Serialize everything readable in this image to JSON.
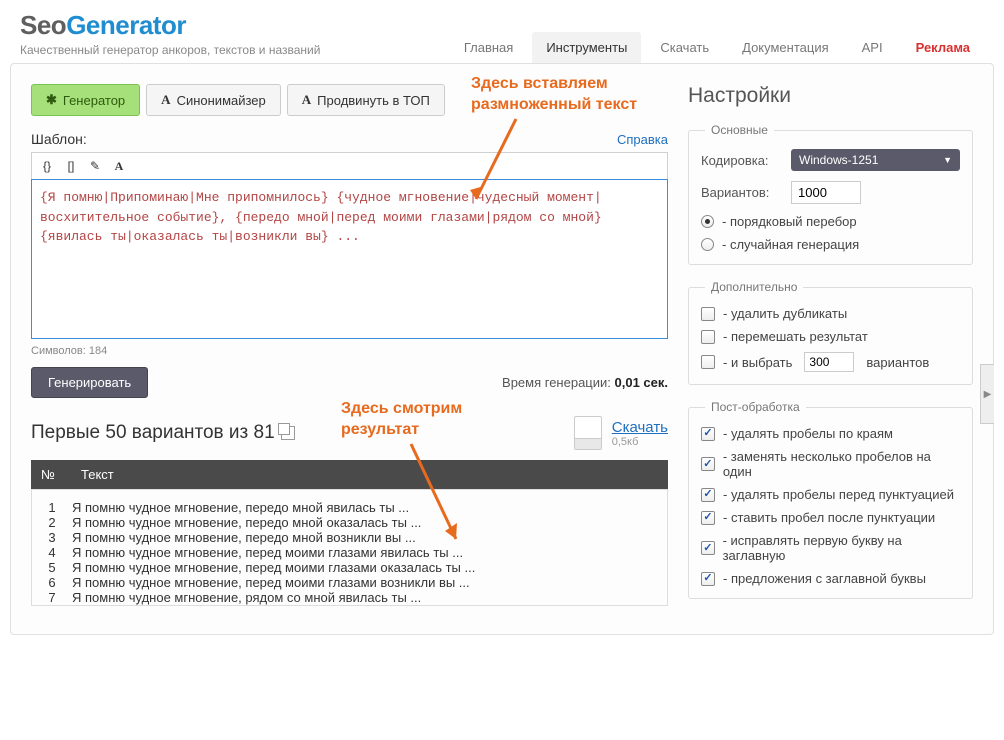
{
  "logo": {
    "part1": "Seo",
    "part2": "Generator"
  },
  "tagline": "Качественный генератор анкоров, текстов и названий",
  "topnav": {
    "home": "Главная",
    "tools": "Инструменты",
    "download": "Скачать",
    "docs": "Документация",
    "api": "API",
    "ad": "Реклама"
  },
  "subtabs": {
    "generator": "Генератор",
    "synonym": "Синонимайзер",
    "promote": "Продвинуть в ТОП"
  },
  "annotations": {
    "insert": "Здесь вставляем\nразмноженный текст",
    "result": "Здесь смотрим\nрезультат"
  },
  "template": {
    "label": "Шаблон:",
    "help": "Справка",
    "text": "{Я помню|Припоминаю|Мне припомнилось} {чудное мгновение|чудесный момент|восхитительное событие}, {передо мной|перед моими глазами|рядом со мной} {явилась ты|оказалась ты|возникли вы} ...",
    "char_count": "Символов: 184"
  },
  "generate": {
    "button": "Генерировать",
    "time_label": "Время генерации: ",
    "time_value": "0,01 сек."
  },
  "results": {
    "title_prefix": "Первые ",
    "title_count": "50",
    "title_mid": " вариантов из ",
    "title_total": "81",
    "download": "Скачать",
    "size": "0,5кб",
    "col_num": "№",
    "col_text": "Текст",
    "rows": [
      "Я помню чудное мгновение, передо мной явилась ты ...",
      "Я помню чудное мгновение, передо мной оказалась ты ...",
      "Я помню чудное мгновение, передо мной возникли вы ...",
      "Я помню чудное мгновение, перед моими глазами явилась ты ...",
      "Я помню чудное мгновение, перед моими глазами оказалась ты ...",
      "Я помню чудное мгновение, перед моими глазами возникли вы ...",
      "Я помню чудное мгновение, рядом со мной явилась ты ..."
    ]
  },
  "settings": {
    "title": "Настройки",
    "main_legend": "Основные",
    "encoding_label": "Кодировка:",
    "encoding_value": "Windows-1251",
    "variants_label": "Вариантов:",
    "variants_value": "1000",
    "mode_sequential": "- порядковый перебор",
    "mode_random": "- случайная генерация",
    "extra_legend": "Дополнительно",
    "remove_dupes": "- удалить дубликаты",
    "shuffle": "- перемешать результат",
    "select_prefix": "- и выбрать",
    "select_value": "300",
    "select_suffix": "вариантов",
    "post_legend": "Пост-обработка",
    "trim": "- удалять пробелы по краям",
    "collapse_spaces": "- заменять несколько пробелов на один",
    "space_punct": "- удалять пробелы перед пунктуацией",
    "space_after_punct": "- ставить пробел после пунктуации",
    "cap_first": "- исправлять первую букву на заглавную",
    "cap_sentence": "- предложения с заглавной буквы"
  }
}
